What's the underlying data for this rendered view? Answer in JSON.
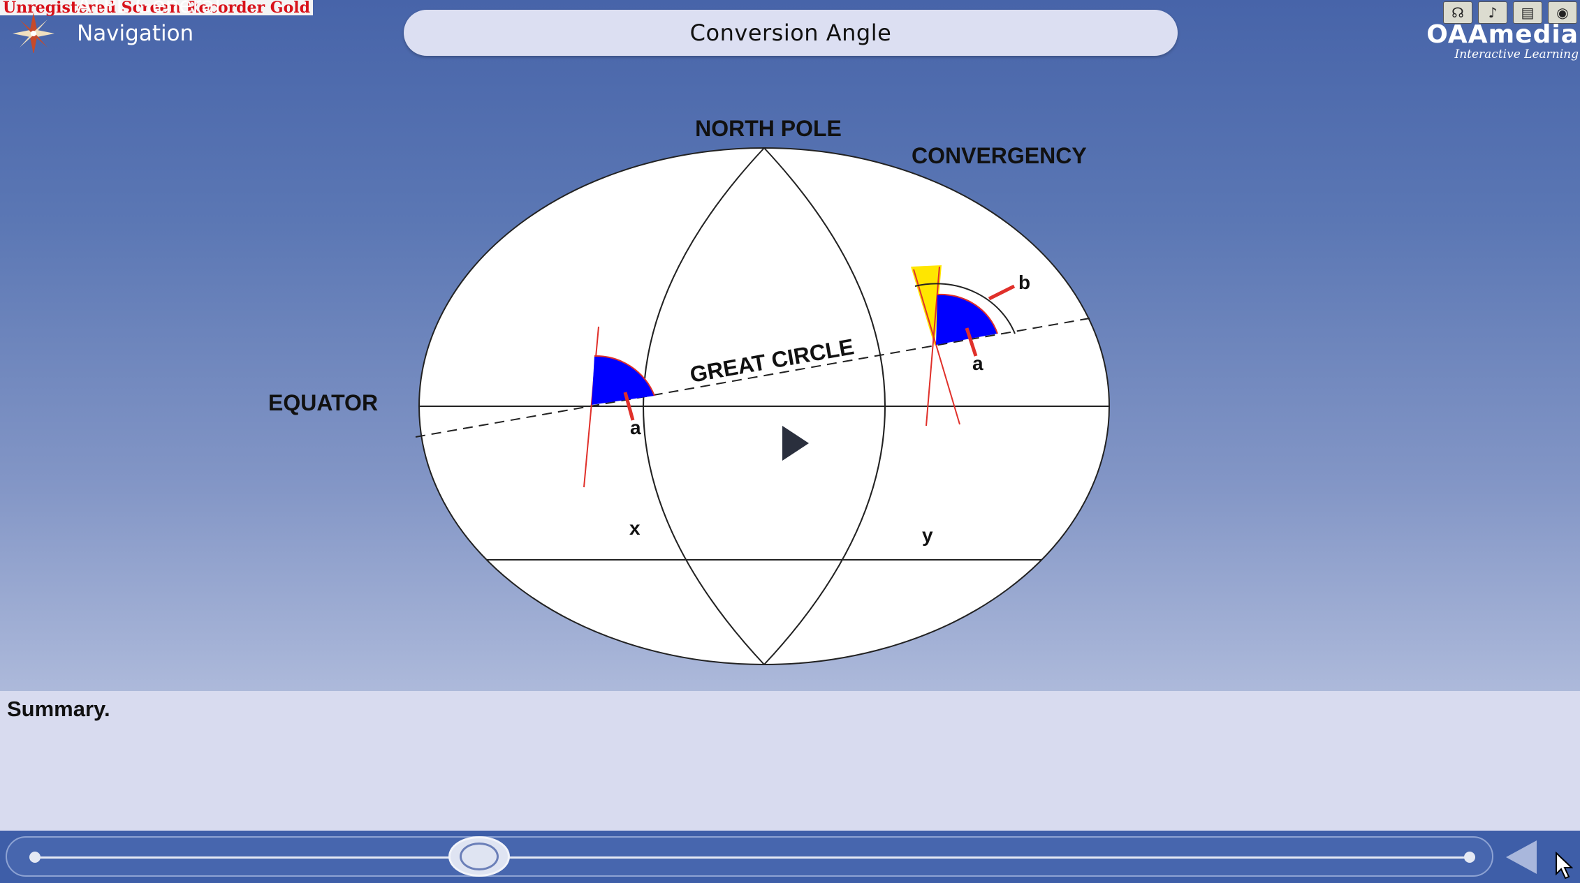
{
  "watermark": "Unregistered Screen Recorder Gold",
  "header": {
    "course_line1": "ATPL General",
    "course_line2": "Navigation",
    "title": "Conversion Angle",
    "icons": [
      "headset-icon",
      "audio-icon",
      "book-icon",
      "eye-icon"
    ],
    "brand": "OAAmedia",
    "brand_tagline": "Interactive Learning"
  },
  "diagram": {
    "north_pole": "NORTH POLE",
    "convergency": "CONVERGENCY",
    "equator": "EQUATOR",
    "great_circle": "GREAT CIRCLE",
    "angle_a_left": "a",
    "angle_a_right": "a",
    "angle_b": "b",
    "point_x": "x",
    "point_y": "y"
  },
  "colors": {
    "angle_fill": "#0000ff",
    "convergency_fill": "#ffe600",
    "meridian_red": "#e0302a",
    "background_top": "#4764a9",
    "panel": "#d8dbef"
  },
  "summary": {
    "label": "Summary."
  },
  "player": {
    "progress": 0.31
  }
}
